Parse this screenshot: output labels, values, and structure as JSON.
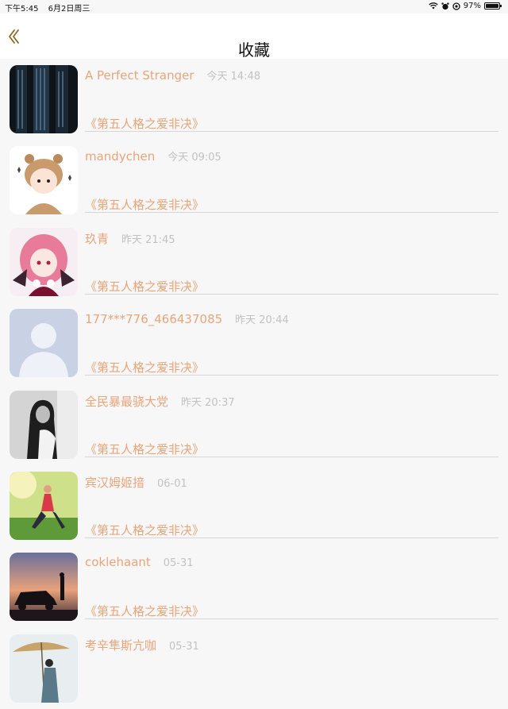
{
  "status_bar": {
    "time": "下午5:45",
    "date": "6月2日周三",
    "battery": "97%",
    "battery_level": 0.97
  },
  "nav": {
    "title": "收藏",
    "back_icon": "chevron-left-icon"
  },
  "colors": {
    "accent": "#e8a57a",
    "meta": "#c2c2c2",
    "divider": "#d6d6d6"
  },
  "items": [
    {
      "name": "A Perfect Stranger",
      "time": "今天 14:48",
      "topic": "《第五人格之爱非决》"
    },
    {
      "name": "mandychen",
      "time": "今天 09:05",
      "topic": "《第五人格之爱非决》"
    },
    {
      "name": "玖青",
      "time": "昨天 21:45",
      "topic": "《第五人格之爱非决》"
    },
    {
      "name": "177***776_466437085",
      "time": "昨天 20:44",
      "topic": "《第五人格之爱非决》"
    },
    {
      "name": "全民暴最骁大党",
      "time": "昨天 20:37",
      "topic": "《第五人格之爱非决》"
    },
    {
      "name": "宾汉姆姬揞",
      "time": "06-01",
      "topic": "《第五人格之爱非决》"
    },
    {
      "name": "coklehaant",
      "time": "05-31",
      "topic": "《第五人格之爱非决》"
    },
    {
      "name": "考辛隼斯亢咖",
      "time": "05-31",
      "topic": ""
    }
  ]
}
